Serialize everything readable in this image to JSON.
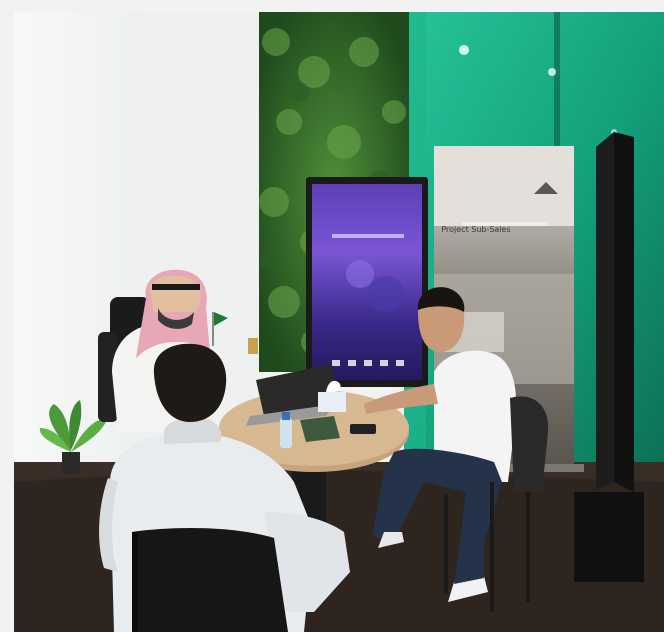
{
  "photo": {
    "screen_heading": "",
    "banner_heading": "",
    "banner_caption": "Project Sub-Sales"
  }
}
